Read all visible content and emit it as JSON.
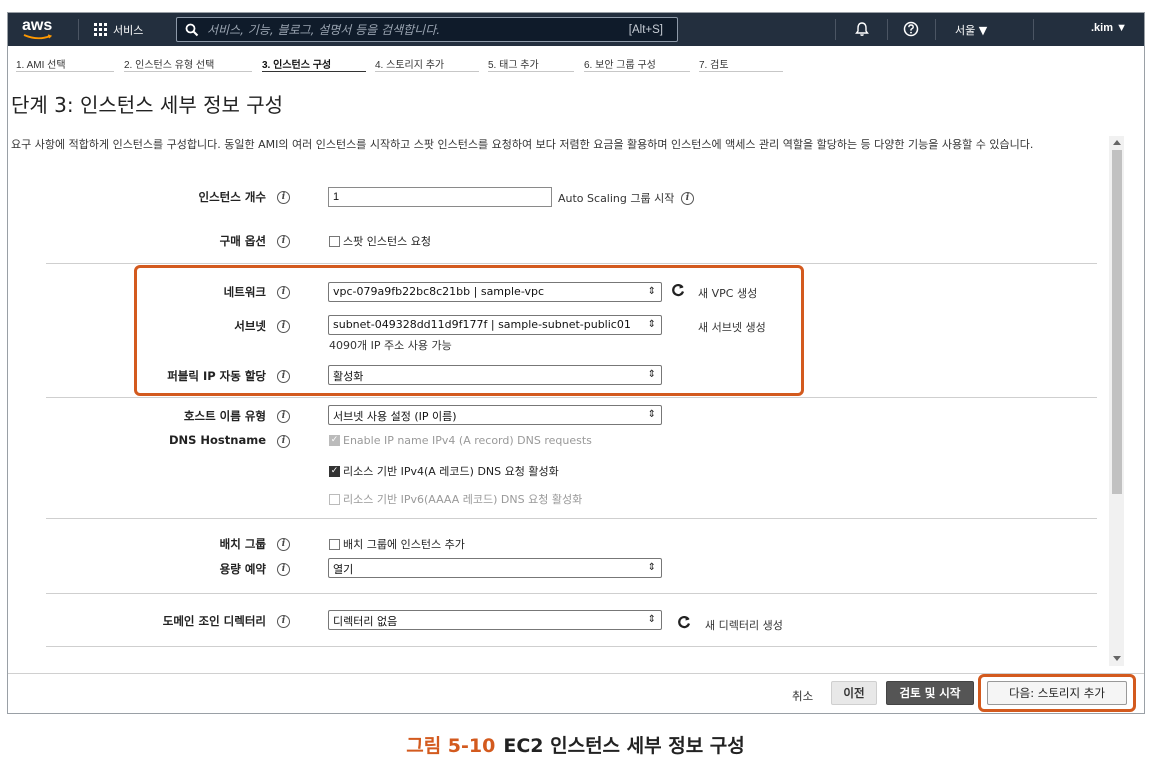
{
  "nav": {
    "logo_text": "aws",
    "services_label": "서비스",
    "search_placeholder": "서비스, 기능, 블로그, 설명서 등을 검색합니다.",
    "search_hotkey": "[Alt+S]",
    "region_label": "서울 ▼",
    "account_label": ".kim ▼"
  },
  "steps": [
    {
      "label": "1. AMI 선택"
    },
    {
      "label": "2. 인스턴스 유형 선택"
    },
    {
      "label": "3. 인스턴스 구성"
    },
    {
      "label": "4. 스토리지 추가"
    },
    {
      "label": "5. 태그 추가"
    },
    {
      "label": "6. 보안 그룹 구성"
    },
    {
      "label": "7. 검토"
    }
  ],
  "page": {
    "title": "단계 3: 인스턴스 세부 정보 구성",
    "description": "요구 사항에 적합하게 인스턴스를 구성합니다. 동일한 AMI의 여러 인스턴스를 시작하고 스팟 인스턴스를 요청하여 보다 저렴한 요금을 활용하며 인스턴스에 액세스 관리 역할을 할당하는 등 다양한 기능을 사용할 수 있습니다."
  },
  "form": {
    "instance_count": {
      "label": "인스턴스 개수",
      "value": "1",
      "autoscaling_label": "Auto Scaling 그룹 시작"
    },
    "purchase_option": {
      "label": "구매 옵션",
      "checkbox_label": "스팟 인스턴스 요청",
      "checked": false
    },
    "network": {
      "label": "네트워크",
      "value": "vpc-079a9fb22bc8c21bb | sample-vpc",
      "create_link": "새 VPC 생성"
    },
    "subnet": {
      "label": "서브넷",
      "value": "subnet-049328dd11d9f177f | sample-subnet-public01",
      "create_link": "새 서브넷 생성",
      "available_ips": "4090개 IP 주소 사용 가능"
    },
    "public_ip": {
      "label": "퍼블릭 IP 자동 할당",
      "value": "활성화"
    },
    "hostname_type": {
      "label": "호스트 이름 유형",
      "value": "서브넷 사용 설정 (IP 이름)"
    },
    "dns_hostname": {
      "label": "DNS Hostname",
      "options": [
        {
          "label": "Enable IP name IPv4 (A record) DNS requests",
          "checked": true,
          "disabled": true
        },
        {
          "label": "리소스 기반 IPv4(A 레코드) DNS 요청 활성화",
          "checked": true,
          "disabled": false
        },
        {
          "label": "리소스 기반 IPv6(AAAA 레코드) DNS 요청 활성화",
          "checked": false,
          "disabled": true
        }
      ]
    },
    "placement_group": {
      "label": "배치 그룹",
      "checkbox_label": "배치 그룹에 인스턴스 추가",
      "checked": false
    },
    "capacity_reservation": {
      "label": "용량 예약",
      "value": "열기"
    },
    "domain_directory": {
      "label": "도메인 조인 디렉터리",
      "value": "디렉터리 없음",
      "create_link": "새 디렉터리 생성"
    }
  },
  "footer": {
    "cancel_label": "취소",
    "prev_label": "이전",
    "review_label": "검토 및 시작",
    "next_label": "다음: 스토리지 추가"
  },
  "caption": {
    "number": "그림 5-10",
    "text": "EC2 인스턴스 세부 정보 구성"
  },
  "colors": {
    "nav_bg": "#232f3e",
    "highlight": "#d35a1e",
    "review_button": "#555555"
  }
}
